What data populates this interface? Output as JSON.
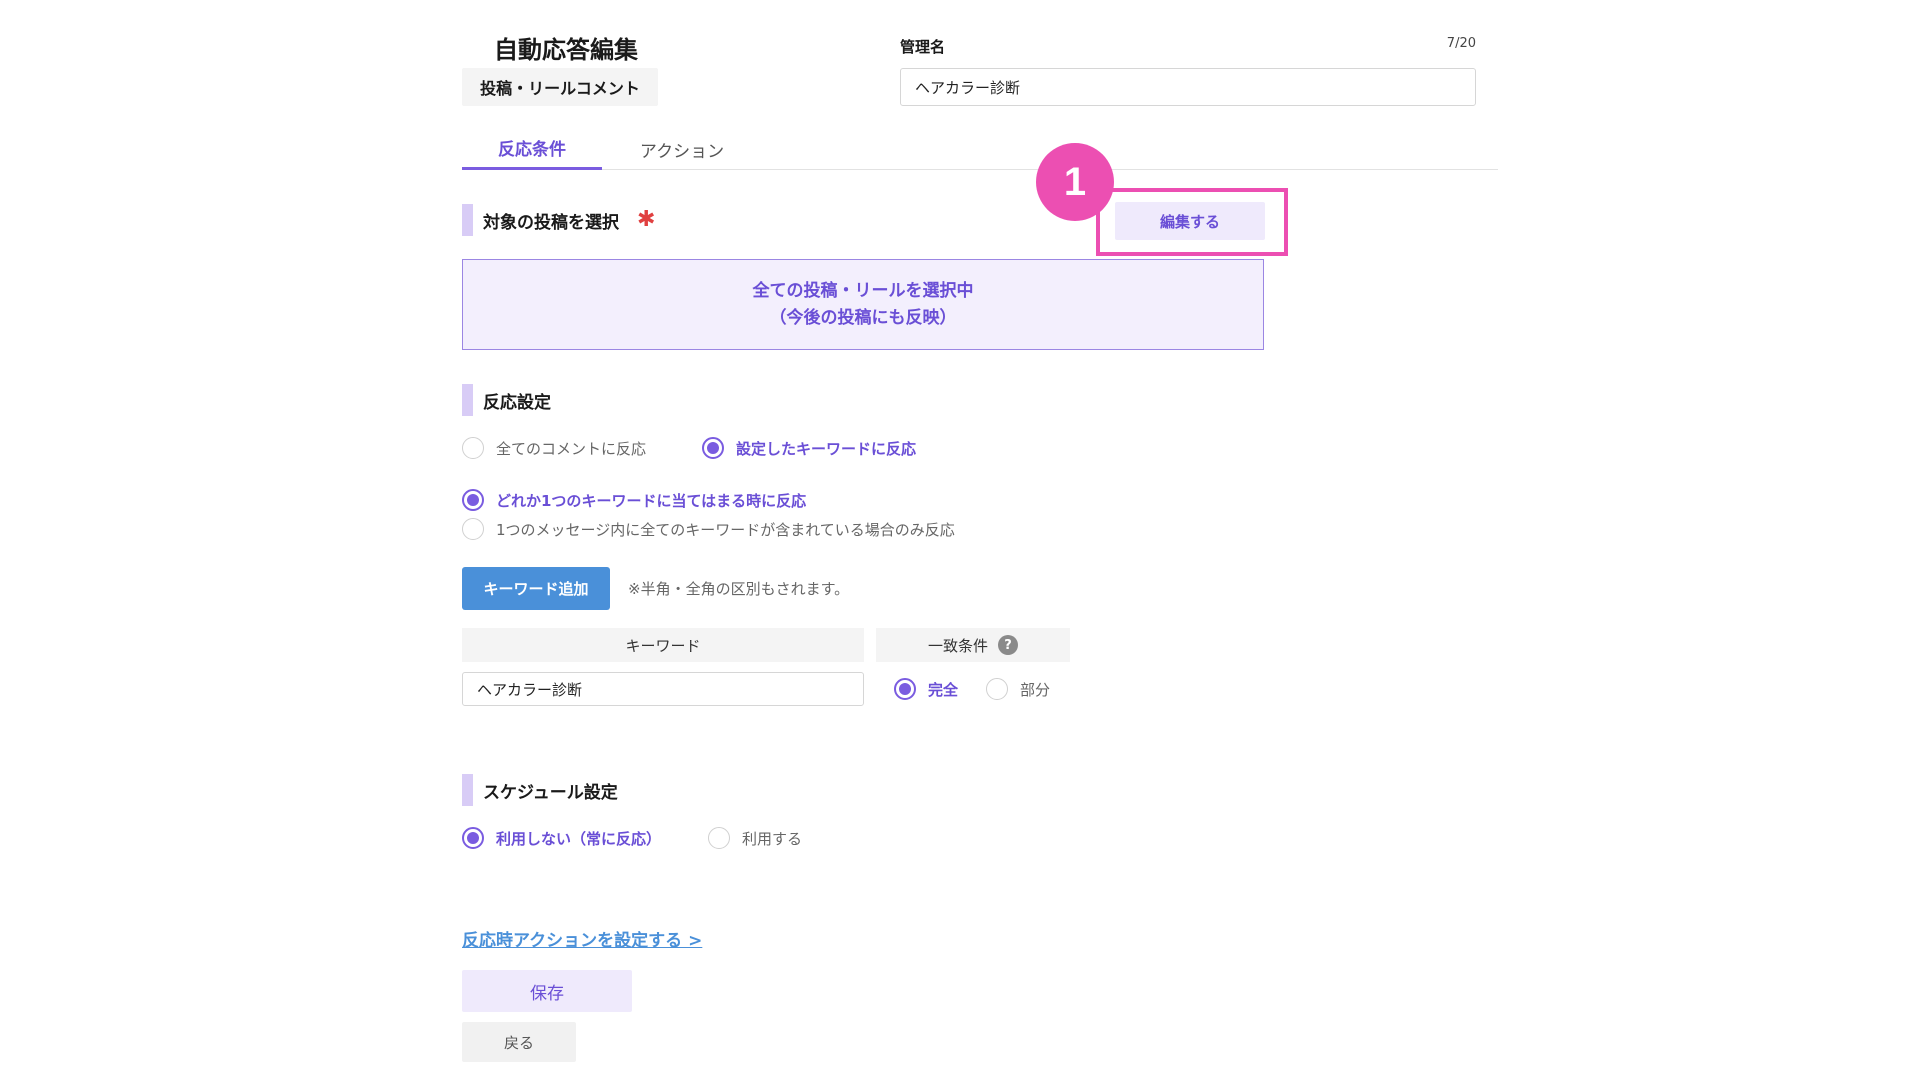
{
  "header": {
    "title": "自動応答編集",
    "type_badge": "投稿・リールコメント",
    "management_name_label": "管理名",
    "management_name_count": "7/20",
    "management_name_value": "ヘアカラー診断"
  },
  "tabs": [
    {
      "label": "反応条件",
      "active": true
    },
    {
      "label": "アクション",
      "active": false
    }
  ],
  "target_posts": {
    "title": "対象の投稿を選択",
    "required_mark": "✱",
    "edit_button": "編集する",
    "callout_number": "1",
    "selected_line1": "全ての投稿・リールを選択中",
    "selected_line2": "（今後の投稿にも反映）"
  },
  "reaction_settings": {
    "title": "反応設定",
    "mode_options": [
      {
        "label": "全てのコメントに反応",
        "selected": false
      },
      {
        "label": "設定したキーワードに反応",
        "selected": true
      }
    ],
    "match_options": [
      {
        "label": "どれか1つのキーワードに当てはまる時に反応",
        "selected": true
      },
      {
        "label": "1つのメッセージ内に全てのキーワードが含まれている場合のみ反応",
        "selected": false
      }
    ],
    "add_keyword_button": "キーワード追加",
    "note": "※半角・全角の区別もされます。",
    "table": {
      "col_keyword": "キーワード",
      "col_condition": "一致条件",
      "help_icon": "?",
      "rows": [
        {
          "keyword": "ヘアカラー診断",
          "conditions": [
            {
              "label": "完全",
              "selected": true
            },
            {
              "label": "部分",
              "selected": false
            }
          ]
        }
      ]
    }
  },
  "schedule": {
    "title": "スケジュール設定",
    "options": [
      {
        "label": "利用しない（常に反応）",
        "selected": true
      },
      {
        "label": "利用する",
        "selected": false
      }
    ]
  },
  "footer": {
    "action_link": "反応時アクションを設定する >",
    "save_button": "保存",
    "back_button": "戻る"
  },
  "colors": {
    "accent_purple": "#6a4fd6",
    "callout_pink": "#ec4fb2",
    "button_blue": "#4a90d9",
    "required_red": "#e04040"
  }
}
